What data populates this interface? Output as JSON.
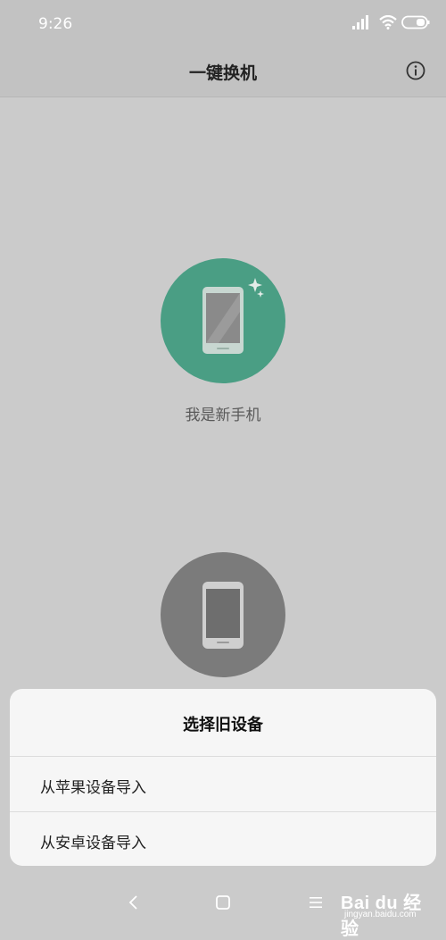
{
  "status_bar": {
    "time": "9:26"
  },
  "header": {
    "title": "一键换机"
  },
  "devices": {
    "new_label": "我是新手机"
  },
  "sheet": {
    "title": "选择旧设备",
    "options": [
      {
        "label": "从苹果设备导入"
      },
      {
        "label": "从安卓设备导入"
      }
    ]
  },
  "watermark": {
    "brand": "Bai du 经验",
    "url": "jingyan.baidu.com"
  },
  "colors": {
    "new_circle": "#4a9e84",
    "old_circle": "#7b7b7b",
    "sheet_bg": "#f6f6f6"
  }
}
